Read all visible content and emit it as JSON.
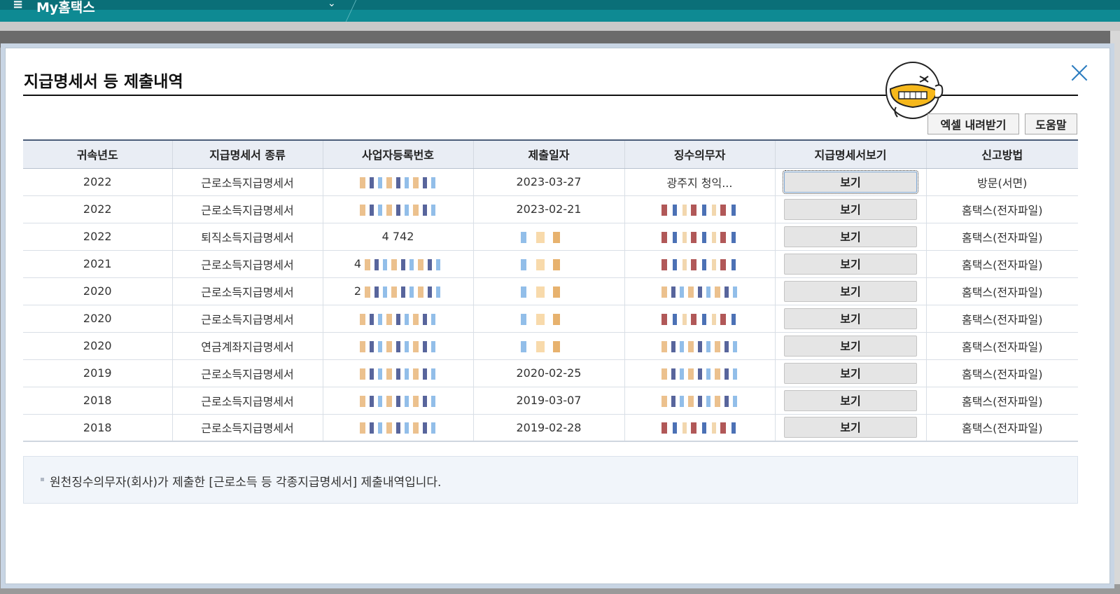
{
  "topbar": {
    "menu_icon": "hamburger-icon",
    "title": "My홈택스",
    "chevron_icon": "chevron-down-icon"
  },
  "modal": {
    "title": "지급명세서 등 제출내역",
    "close_icon": "close-icon",
    "mascot_icon": "mascot-character-icon",
    "excel_button": "엑셀 내려받기",
    "help_button": "도움말"
  },
  "table": {
    "headers": [
      "귀속년도",
      "지급명세서 종류",
      "사업자등록번호",
      "제출일자",
      "징수의무자",
      "지급명세서보기",
      "신고방법"
    ],
    "rows": [
      {
        "year": "2022",
        "type": "근로소득지급명세서",
        "bizno": "",
        "date": "2023-03-27",
        "payer": "광주지 청익...",
        "view": "보기",
        "method": "방문(서면)"
      },
      {
        "year": "2022",
        "type": "근로소득지급명세서",
        "bizno": "",
        "date": "2023-02-21",
        "payer": "",
        "view": "보기",
        "method": "홈택스(전자파일)"
      },
      {
        "year": "2022",
        "type": "퇴직소득지급명세서",
        "bizno": "4 742",
        "date": "",
        "payer": "",
        "view": "보기",
        "method": "홈택스(전자파일)"
      },
      {
        "year": "2021",
        "type": "근로소득지급명세서",
        "bizno": "4",
        "date": "",
        "payer": "",
        "view": "보기",
        "method": "홈택스(전자파일)"
      },
      {
        "year": "2020",
        "type": "근로소득지급명세서",
        "bizno": "2",
        "date": "",
        "payer": "",
        "view": "보기",
        "method": "홈택스(전자파일)"
      },
      {
        "year": "2020",
        "type": "근로소득지급명세서",
        "bizno": "",
        "date": "",
        "payer": "",
        "view": "보기",
        "method": "홈택스(전자파일)"
      },
      {
        "year": "2020",
        "type": "연금계좌지급명세서",
        "bizno": "",
        "date": "",
        "payer": "",
        "view": "보기",
        "method": "홈택스(전자파일)"
      },
      {
        "year": "2019",
        "type": "근로소득지급명세서",
        "bizno": "",
        "date": "2020-02-25",
        "payer": "",
        "view": "보기",
        "method": "홈택스(전자파일)"
      },
      {
        "year": "2018",
        "type": "근로소득지급명세서",
        "bizno": "",
        "date": "2019-03-07",
        "payer": "",
        "view": "보기",
        "method": "홈택스(전자파일)"
      },
      {
        "year": "2018",
        "type": "근로소득지급명세서",
        "bizno": "",
        "date": "2019-02-28",
        "payer": "",
        "view": "보기",
        "method": "홈택스(전자파일)"
      }
    ]
  },
  "note": {
    "text": "원천징수의무자(회사)가 제출한 [근로소득 등 각종지급명세서] 제출내역입니다."
  }
}
